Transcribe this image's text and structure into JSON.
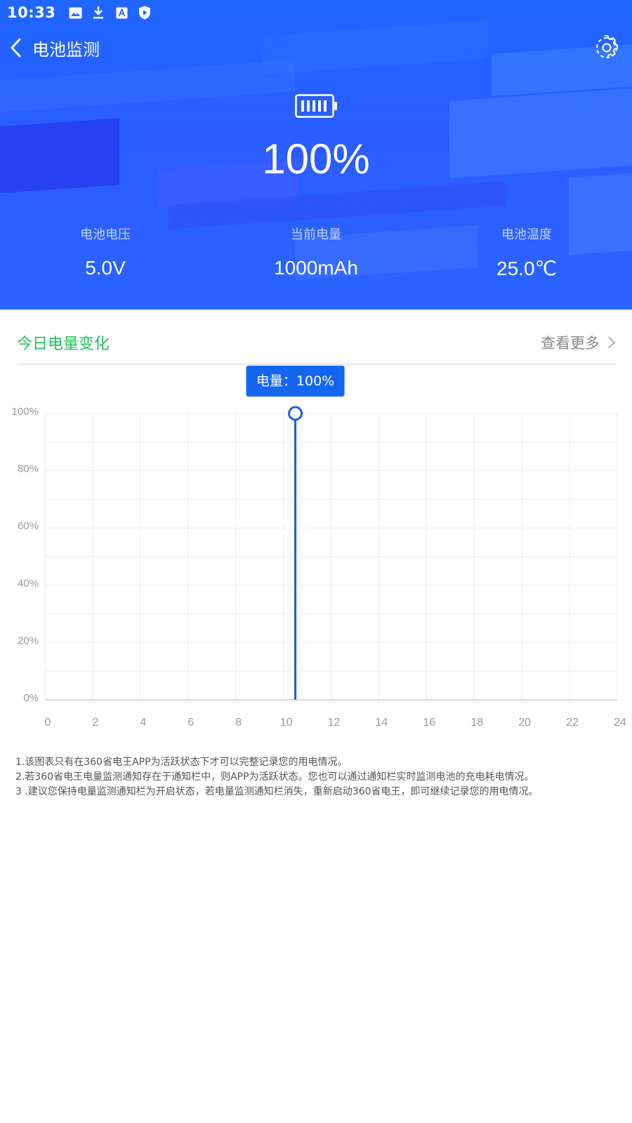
{
  "status_bar": {
    "time": "10:33",
    "icons": [
      "image-icon",
      "download-icon",
      "font-icon",
      "play-shield-icon"
    ]
  },
  "header": {
    "title": "电池监测",
    "back_icon": "chevron-left-icon",
    "settings_icon": "gear-icon"
  },
  "battery": {
    "icon": "battery-full-icon",
    "percent": "100%",
    "stats": [
      {
        "label": "电池电压",
        "value": "5.0V"
      },
      {
        "label": "当前电量",
        "value": "1000mAh"
      },
      {
        "label": "电池温度",
        "value": "25.0℃"
      }
    ]
  },
  "section": {
    "title": "今日电量变化",
    "more_label": "查看更多"
  },
  "colors": {
    "header_blue": "#2a63ff",
    "accent_green": "#1fbf5a",
    "line_blue": "#1a5fd6",
    "tooltip_blue": "#1466f0"
  },
  "chart_data": {
    "type": "line",
    "x": [
      10.5
    ],
    "values": [
      100
    ],
    "xticks": [
      "0",
      "2",
      "4",
      "6",
      "8",
      "10",
      "12",
      "14",
      "16",
      "18",
      "20",
      "22",
      "24"
    ],
    "yticks": [
      "0%",
      "20%",
      "40%",
      "60%",
      "80%",
      "100%"
    ],
    "xlim": [
      0,
      24
    ],
    "ylim": [
      0,
      100
    ],
    "grid": true,
    "tooltip": "电量：100%"
  },
  "notes": [
    "1.该图表只有在360省电王APP为活跃状态下才可以完整记录您的用电情况。",
    "2.若360省电王电量监测通知存在于通知栏中，则APP为活跃状态。您也可以通过通知栏实时监测电池的充电耗电情况。",
    "3 .建议您保持电量监测通知栏为开启状态，若电量监测通知栏消失，重新启动360省电王，即可继续记录您的用电情况。"
  ]
}
